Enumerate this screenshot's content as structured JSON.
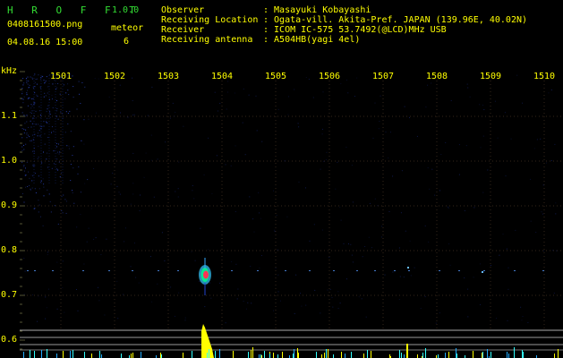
{
  "app": {
    "name": "H R O F F T",
    "version": "1.0.0"
  },
  "file": {
    "name": "0408161500.png",
    "datetime": "04.08.16 15:00"
  },
  "meteor": {
    "label": "meteor",
    "count": "6"
  },
  "station": {
    "fields": [
      {
        "label": "Observer",
        "value": ": Masayuki Kobayashi"
      },
      {
        "label": "Receiving Location",
        "value": ": Ogata-vill. Akita-Pref. JAPAN (139.96E, 40.02N)"
      },
      {
        "label": "Receiver",
        "value": ": ICOM IC-575 53.7492(@LCD)MHz USB"
      },
      {
        "label": "Receiving antenna",
        "value": ": A504HB(yagi 4el)"
      }
    ]
  },
  "axes": {
    "y_unit": "kHz",
    "y_ticks": [
      "1.1",
      "1.0",
      "0.9",
      "0.8",
      "0.7",
      "0.6"
    ],
    "x_ticks": [
      "1501",
      "1502",
      "1503",
      "1504",
      "1505",
      "1506",
      "1507",
      "1508",
      "1509",
      "1510"
    ]
  },
  "colors": {
    "text": "#ffff00",
    "app_title": "#33dd33",
    "grid": "#3a2a1a",
    "faint_echo": "#1a3399",
    "meteor_core": "#ff3355",
    "meteor_halo": "#33ccff",
    "meteor_base": "#ffff00",
    "trace_lines": "#aaaaaa"
  }
}
